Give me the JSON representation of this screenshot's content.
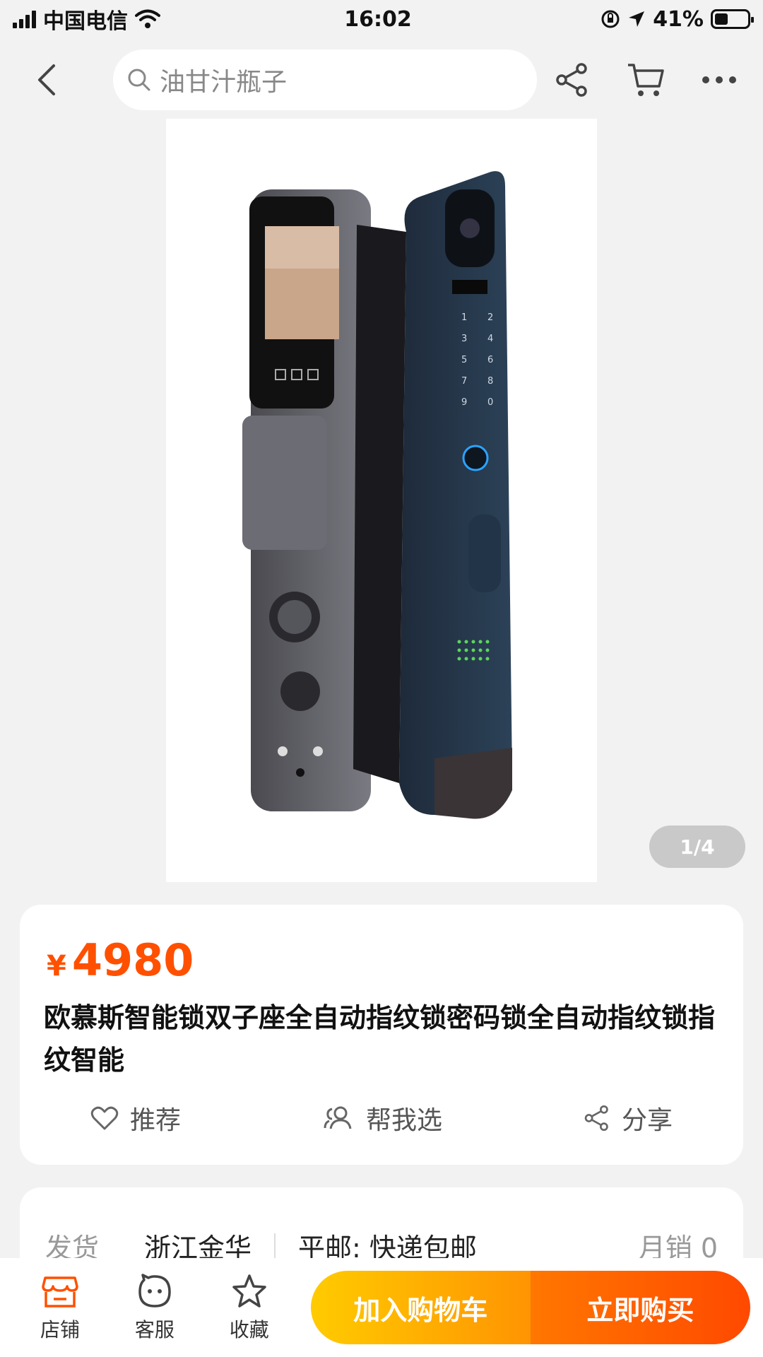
{
  "status_bar": {
    "carrier": "中国电信",
    "time": "16:02",
    "battery": "41%",
    "battery_level": 0.41
  },
  "nav": {
    "search_placeholder": "油甘汁瓶子"
  },
  "gallery": {
    "page_indicator": "1/4"
  },
  "product": {
    "currency": "¥",
    "price": "4980",
    "title": "欧慕斯智能锁双子座全自动指纹锁密码锁全自动指纹锁指纹智能"
  },
  "actions": {
    "recommend": "推荐",
    "help_choose": "帮我选",
    "share": "分享"
  },
  "shipping": {
    "label": "发货",
    "origin": "浙江金华",
    "method": "平邮: 快递包邮",
    "sales": "月销 0"
  },
  "bottom_bar": {
    "store": "店铺",
    "service": "客服",
    "favorite": "收藏",
    "add_to_cart": "加入购物车",
    "buy_now": "立即购买"
  },
  "colors": {
    "accent": "#ff5000",
    "cart_gradient": [
      "#ffcb00",
      "#ff9402"
    ],
    "buy_gradient": [
      "#ff7700",
      "#ff4900"
    ]
  },
  "icons": [
    "signal-icon",
    "wifi-icon",
    "orientation-lock-icon",
    "location-icon",
    "battery-icon",
    "back-icon",
    "search-icon",
    "share-icon",
    "cart-icon",
    "more-icon",
    "heart-icon",
    "users-icon",
    "store-icon",
    "service-icon",
    "star-icon"
  ]
}
